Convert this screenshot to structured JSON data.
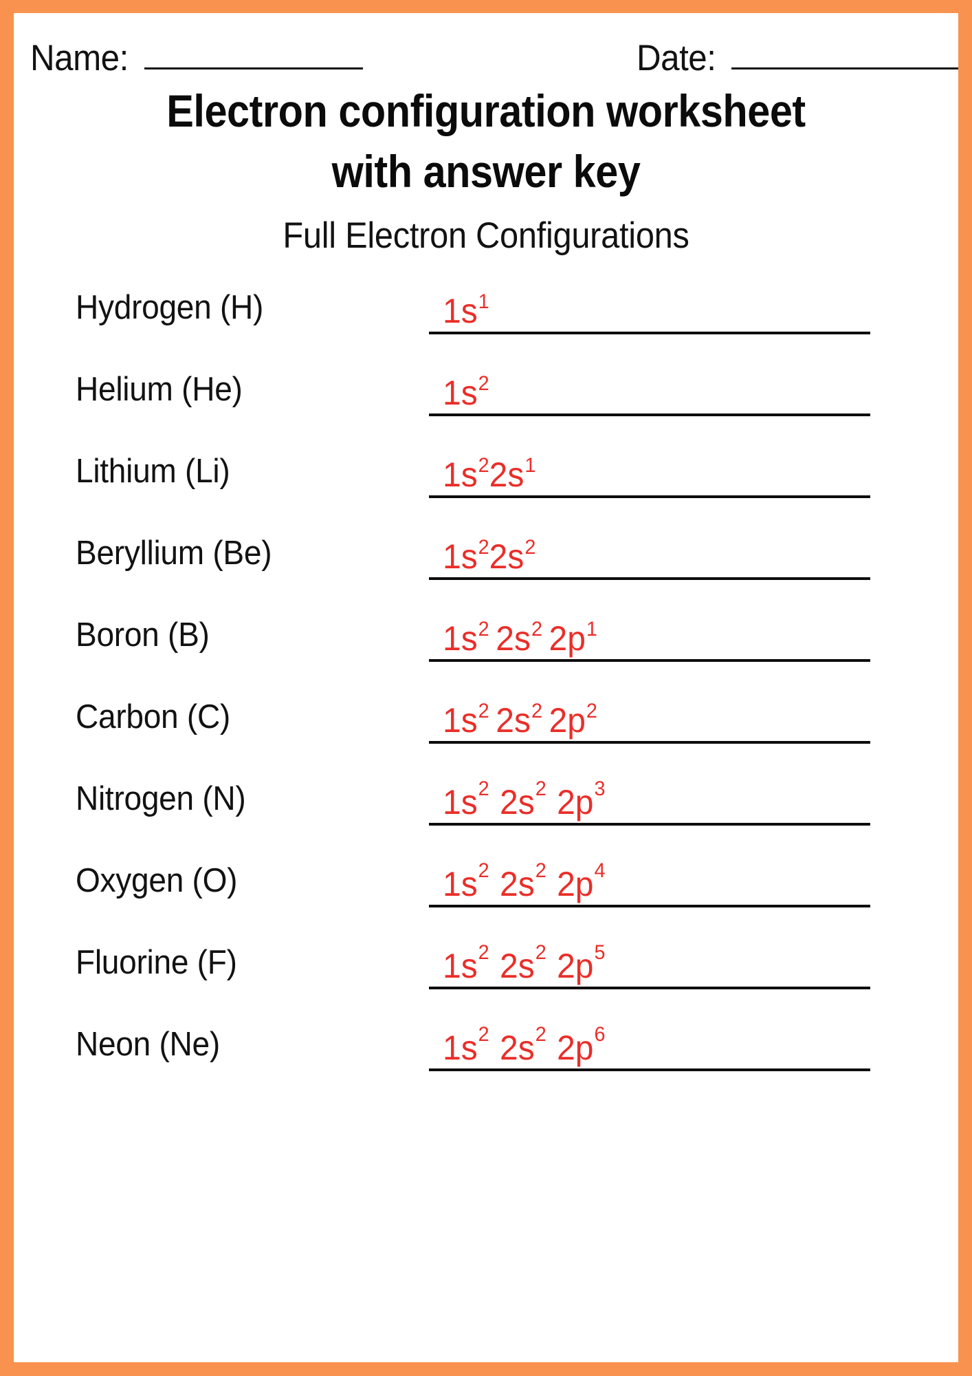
{
  "page": {
    "border_color": "#f8924e",
    "background_color": "#ffffff",
    "answer_color": "#ea2e29",
    "text_color": "#121212"
  },
  "header": {
    "name_label": "Name:",
    "date_label": "Date:"
  },
  "title": {
    "line1": "Electron configuration worksheet",
    "line2": "with answer key"
  },
  "section": {
    "heading": "Full Electron Configurations"
  },
  "rows": [
    {
      "element": "Hydrogen (H)",
      "groups": [
        {
          "base": "1s",
          "sup": "1"
        }
      ],
      "spaced": false,
      "raised": false
    },
    {
      "element": "Helium (He)",
      "groups": [
        {
          "base": "1s",
          "sup": "2"
        }
      ],
      "spaced": false,
      "raised": false
    },
    {
      "element": "Lithium (Li)",
      "groups": [
        {
          "base": "1s",
          "sup": "2"
        },
        {
          "base": "2s",
          "sup": "1"
        }
      ],
      "spaced": false,
      "raised": false
    },
    {
      "element": "Beryllium (Be)",
      "groups": [
        {
          "base": "1s",
          "sup": "2"
        },
        {
          "base": "2s",
          "sup": "2"
        }
      ],
      "spaced": false,
      "raised": false
    },
    {
      "element": "Boron (B)",
      "groups": [
        {
          "base": "1s",
          "sup": "2"
        },
        {
          "base": "2s",
          "sup": "2"
        },
        {
          "base": "2p",
          "sup": "1"
        }
      ],
      "spaced": true,
      "raised": false
    },
    {
      "element": "Carbon (C)",
      "groups": [
        {
          "base": "1s",
          "sup": "2"
        },
        {
          "base": "2s",
          "sup": "2"
        },
        {
          "base": "2p",
          "sup": "2"
        }
      ],
      "spaced": true,
      "raised": false
    },
    {
      "element": "Nitrogen (N)",
      "groups": [
        {
          "base": "1s",
          "sup": "2"
        },
        {
          "base": "2s",
          "sup": "2"
        },
        {
          "base": "2p",
          "sup": "3"
        }
      ],
      "spaced": true,
      "raised": true
    },
    {
      "element": "Oxygen (O)",
      "groups": [
        {
          "base": "1s",
          "sup": "2"
        },
        {
          "base": "2s",
          "sup": "2"
        },
        {
          "base": "2p",
          "sup": "4"
        }
      ],
      "spaced": true,
      "raised": true
    },
    {
      "element": "Fluorine (F)",
      "groups": [
        {
          "base": "1s",
          "sup": "2"
        },
        {
          "base": "2s",
          "sup": "2"
        },
        {
          "base": "2p",
          "sup": "5"
        }
      ],
      "spaced": true,
      "raised": true
    },
    {
      "element": "Neon (Ne)",
      "groups": [
        {
          "base": "1s",
          "sup": "2"
        },
        {
          "base": "2s",
          "sup": "2"
        },
        {
          "base": "2p",
          "sup": "6"
        }
      ],
      "spaced": true,
      "raised": true
    }
  ]
}
